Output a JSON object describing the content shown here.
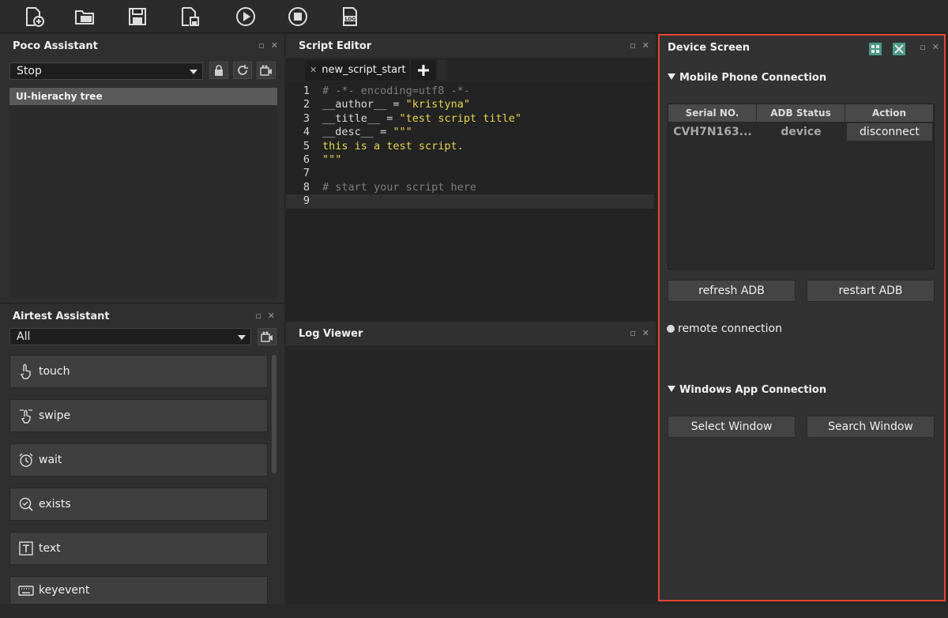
{
  "toolbar": {
    "buttons": [
      "new-file",
      "open-folder",
      "save",
      "save-as",
      "run",
      "stop",
      "log"
    ]
  },
  "poco": {
    "title": "Poco Assistant",
    "mode_value": "Stop",
    "tree_header": "UI-hierachy tree"
  },
  "airtest": {
    "title": "Airtest Assistant",
    "filter_value": "All",
    "actions": [
      "touch",
      "swipe",
      "wait",
      "exists",
      "text",
      "keyevent"
    ]
  },
  "editor": {
    "title": "Script Editor",
    "tab_name": "new_script_start",
    "lines": [
      {
        "n": "1",
        "parts": [
          {
            "t": "# -*- encoding=utf8 -*-",
            "c": "c-comment"
          }
        ]
      },
      {
        "n": "2",
        "parts": [
          {
            "t": "__author__ = ",
            "c": "c-plain"
          },
          {
            "t": "\"kristyna\"",
            "c": "c-str"
          }
        ]
      },
      {
        "n": "3",
        "parts": [
          {
            "t": "__title__ = ",
            "c": "c-plain"
          },
          {
            "t": "\"test script title\"",
            "c": "c-str"
          }
        ]
      },
      {
        "n": "4",
        "parts": [
          {
            "t": "__desc__ = ",
            "c": "c-plain"
          },
          {
            "t": "\"\"\"",
            "c": "c-str"
          }
        ]
      },
      {
        "n": "5",
        "parts": [
          {
            "t": "this is a test script.",
            "c": "c-str"
          }
        ]
      },
      {
        "n": "6",
        "parts": [
          {
            "t": "\"\"\"",
            "c": "c-str"
          }
        ]
      },
      {
        "n": "7",
        "parts": []
      },
      {
        "n": "8",
        "parts": [
          {
            "t": "# start your script here",
            "c": "c-comment"
          }
        ]
      },
      {
        "n": "9",
        "parts": []
      }
    ]
  },
  "log": {
    "title": "Log Viewer"
  },
  "device": {
    "title": "Device Screen",
    "mobile_section": "Mobile Phone Connection",
    "table_headers": [
      "Serial NO.",
      "ADB Status",
      "Action"
    ],
    "row": {
      "serial": "CVH7N163...",
      "status": "device",
      "action": "disconnect"
    },
    "refresh_label": "refresh ADB",
    "restart_label": "restart ADB",
    "remote_label": "remote connection",
    "windows_section": "Windows App Connection",
    "select_window_label": "Select Window",
    "search_window_label": "Search Window"
  },
  "colors": {
    "highlight_border": "#e8452f",
    "string_color": "#e8d44d",
    "comment_color": "#7d7d7d"
  }
}
